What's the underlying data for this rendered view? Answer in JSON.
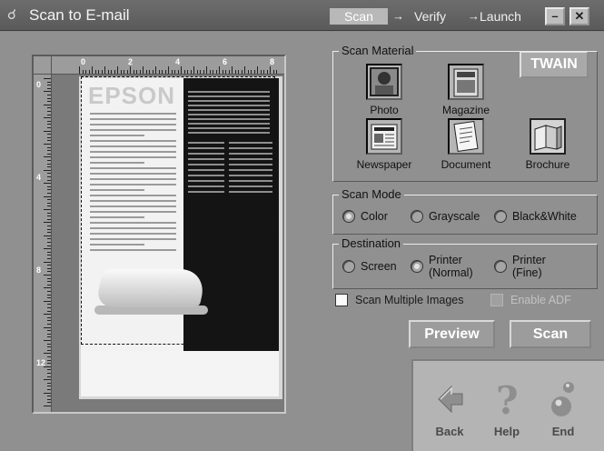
{
  "window": {
    "title": "Scan to E-mail",
    "steps": [
      {
        "label": "Scan",
        "active": true
      },
      {
        "label": "Verify",
        "active": false
      },
      {
        "label": "Launch",
        "active": false
      }
    ],
    "step_arrow": "→",
    "minimize_symbol": "–",
    "close_symbol": "✕"
  },
  "preview": {
    "ruler_top_labels": [
      "0",
      "2",
      "4",
      "6",
      "8"
    ],
    "ruler_left_labels": [
      "0",
      "4",
      "8",
      "12"
    ],
    "brochure_logo": "EPSON"
  },
  "twain_button": "TWAIN",
  "scan_material": {
    "title": "Scan Material",
    "items": [
      {
        "label": "Photo",
        "icon": "photo-icon",
        "selected": false
      },
      {
        "label": "Magazine",
        "icon": "magazine-icon",
        "selected": false
      },
      {
        "label": "Newspaper",
        "icon": "newspaper-icon",
        "selected": false
      },
      {
        "label": "Document",
        "icon": "document-icon",
        "selected": false
      },
      {
        "label": "Brochure",
        "icon": "brochure-icon",
        "selected": true
      }
    ]
  },
  "scan_mode": {
    "title": "Scan Mode",
    "options": [
      "Color",
      "Grayscale",
      "Black&White"
    ],
    "selected": "Color"
  },
  "destination": {
    "title": "Destination",
    "options": [
      {
        "line1": "Screen",
        "line2": ""
      },
      {
        "line1": "Printer",
        "line2": "(Normal)"
      },
      {
        "line1": "Printer",
        "line2": "(Fine)"
      }
    ],
    "selected": "Printer (Normal)"
  },
  "options": {
    "scan_multiple": {
      "label": "Scan Multiple Images",
      "checked": false,
      "enabled": true
    },
    "enable_adf": {
      "label": "Enable ADF",
      "checked": false,
      "enabled": false
    }
  },
  "buttons": {
    "preview": "Preview",
    "scan": "Scan"
  },
  "nav": {
    "back": "Back",
    "help": "Help",
    "end": "End"
  }
}
